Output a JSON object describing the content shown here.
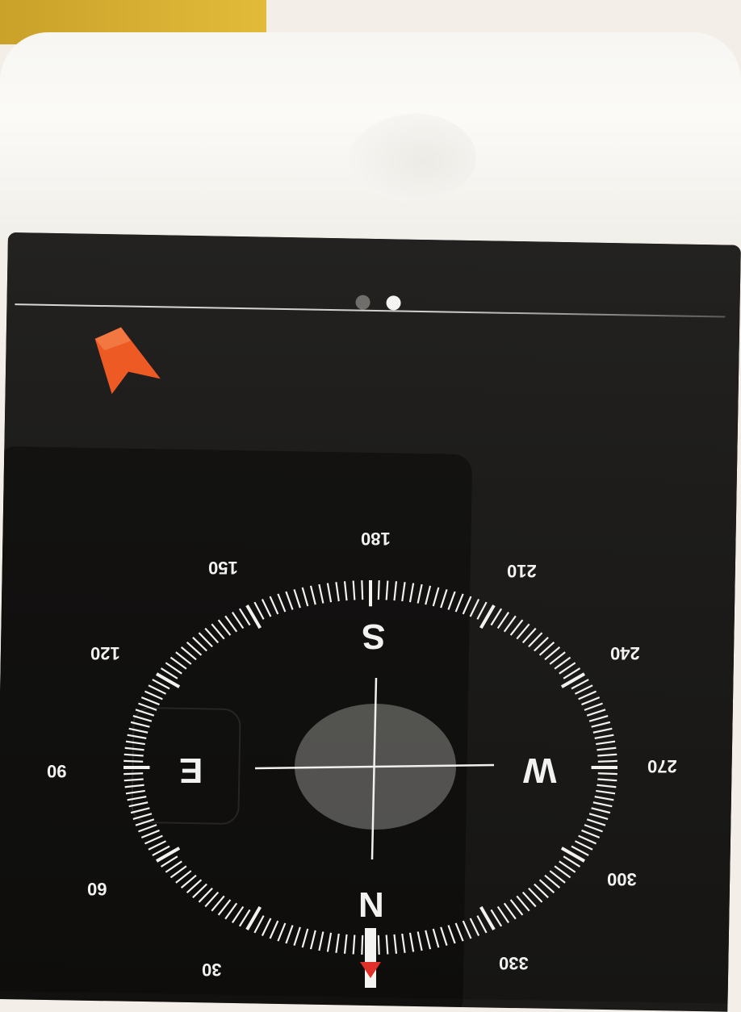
{
  "status_bar": {
    "pages": [
      {
        "active": false
      },
      {
        "active": true
      }
    ]
  },
  "compass": {
    "cardinals": {
      "north": "N",
      "east": "E",
      "south": "S",
      "west": "W"
    },
    "degree_labels": [
      "30",
      "60",
      "90",
      "120",
      "150",
      "180",
      "210",
      "240",
      "270",
      "300",
      "330"
    ],
    "heading_marker_color": "#e0302a",
    "nav_arrow_color": "#ee5a24"
  }
}
